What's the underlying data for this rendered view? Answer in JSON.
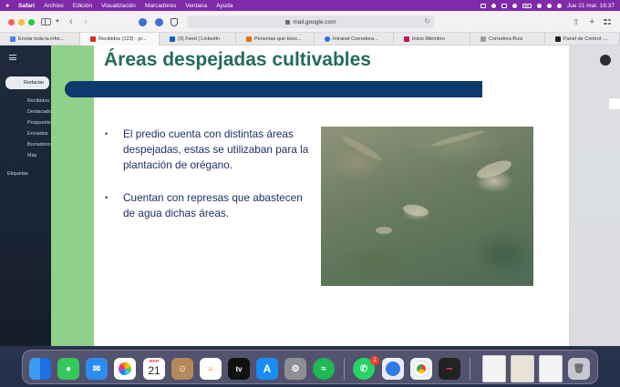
{
  "menubar": {
    "app": "Safari",
    "items": [
      "Archivo",
      "Edición",
      "Visualización",
      "Marcadores",
      "Ventana",
      "Ayuda"
    ],
    "clock": "Jue 21 mar.  16:37"
  },
  "toolbar": {
    "url": "mail.google.com"
  },
  "tabs": [
    {
      "label": "Enviar toda la infor...",
      "color": "#4285f4"
    },
    {
      "label": "Recibidos (123) - pr...",
      "color": "#d93025"
    },
    {
      "label": "(9) Feed | LinkedIn",
      "color": "#0a66c2"
    },
    {
      "label": "Personas que búsc...",
      "color": "#e8710a"
    },
    {
      "label": "Intranet Corredora...",
      "color": "#1a73e8"
    },
    {
      "label": "Inicio Miembro",
      "color": "#c2185b"
    },
    {
      "label": "Corredora Ruiz",
      "color": "#9e9e9e"
    },
    {
      "label": "Panel de Control -...",
      "color": "#222222"
    }
  ],
  "gmail_sidebar": {
    "compose": "Redactar",
    "items": [
      "Recibidos",
      "Destacados",
      "Pospuestos",
      "Enviados",
      "Borradores",
      "Más"
    ],
    "labels_header": "Etiquetas"
  },
  "slide": {
    "title": "Áreas despejadas cultivables",
    "bullets": [
      "El predio cuenta con distintas áreas despejadas, estas se utilizaban para la plantación de orégano.",
      " Cuentan con represas que abastecen de agua dichas áreas."
    ],
    "bullet_mark": "•",
    "colors": {
      "title": "#246b5e",
      "rule": "#0d3a6d",
      "left_bar": "#8fd18a",
      "text": "#1f2f66"
    }
  },
  "dock": {
    "calendar_month": "MAR",
    "calendar_day": "21",
    "tv_label": "tv",
    "whatsapp_badge": "1",
    "apps": [
      "finder",
      "messages",
      "mail",
      "photos",
      "calendar",
      "contacts",
      "reminders",
      "apple-tv",
      "app-store",
      "system-settings",
      "spotify",
      "whatsapp",
      "safari",
      "chrome",
      "voice-memos",
      "preview",
      "trash"
    ]
  }
}
